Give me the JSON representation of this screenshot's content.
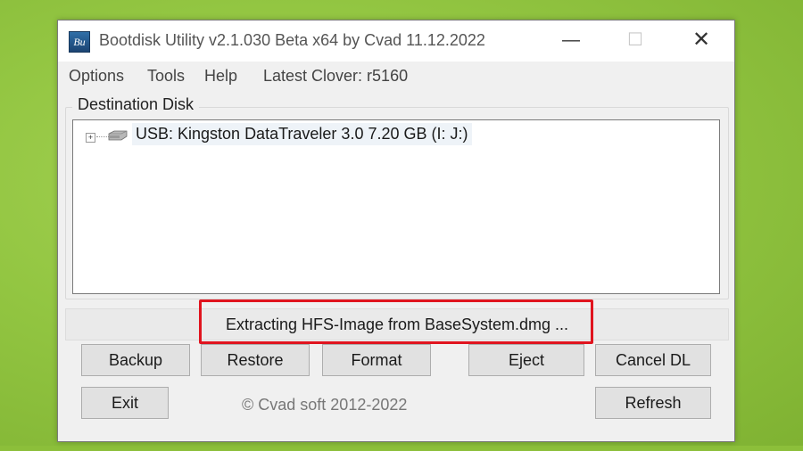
{
  "window": {
    "title": "Bootdisk Utility v2.1.030 Beta x64 by Cvad 11.12.2022",
    "icon_text": "Bu",
    "controls": {
      "minimize": "—",
      "maximize": "☐",
      "close": "✕"
    }
  },
  "menu": {
    "items": [
      "Options",
      "Tools",
      "Help"
    ],
    "clover_info": "Latest Clover: r5160"
  },
  "destination": {
    "label": "Destination Disk",
    "disks": [
      {
        "label": "USB: Kingston DataTraveler 3.0 7.20 GB (I: J:)",
        "icon": "usb-drive-icon",
        "expander": "+"
      }
    ]
  },
  "status": {
    "text": "Extracting HFS-Image from BaseSystem.dmg ..."
  },
  "buttons": {
    "backup": "Backup",
    "restore": "Restore",
    "format": "Format",
    "eject": "Eject",
    "cancel_dl": "Cancel DL",
    "exit": "Exit",
    "refresh": "Refresh"
  },
  "footer": {
    "copyright": "© Cvad soft 2012-2022"
  },
  "colors": {
    "desktop": "#8cbf3a",
    "window_bg": "#f0f0f0",
    "highlight": "#e0141e"
  }
}
